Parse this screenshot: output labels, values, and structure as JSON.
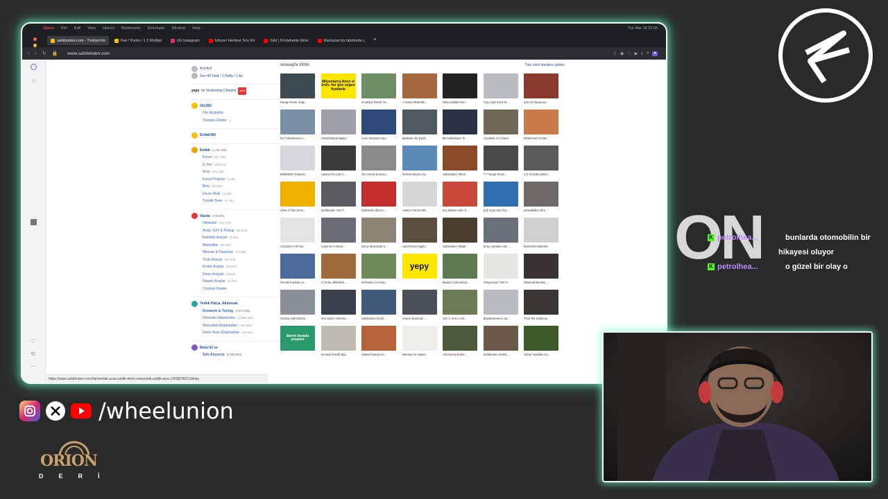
{
  "browser": {
    "menubar": {
      "brand": "Opera",
      "items": [
        "File",
        "Edit",
        "View",
        "History",
        "Bookmarks",
        "Developer",
        "Window",
        "Help"
      ],
      "clock": "Tue Mar 18 22:50"
    },
    "tabs": [
      {
        "label": "sahibinden.com - Türkiye'nin",
        "active": true,
        "color": "#f2c300"
      },
      {
        "label": "Fiat / Punto / 1.3 Multijet",
        "active": false,
        "color": "#f2c300"
      },
      {
        "label": "(4) Instagram",
        "active": false,
        "color": "#e1306c"
      },
      {
        "label": "İzleyen Herkesi Ters Kö",
        "active": false,
        "color": "#ff0000"
      },
      {
        "label": "Gibi | Köstebekle tütün",
        "active": false,
        "color": "#ff0000"
      },
      {
        "label": "Ramazan'da fabrikada ç",
        "active": false,
        "color": "#ff0000"
      }
    ],
    "tab_add": "+",
    "url": "www.sahibinden.com",
    "status_url": "https://www.sahibinden.com/ilan/emlak-arsa-satilik-deniz-manzarali-satilik-arsa-1269878621/detay"
  },
  "categories": {
    "top": [
      {
        "label": "Acil Acil",
        "icon": "clock-icon"
      },
      {
        "label": "Son 48 Saat / 1 Hafta / 1 Ay",
        "icon": "clock-icon"
      }
    ],
    "yepy": {
      "brand": "yepy",
      "label": "ile Yenilenmiş Cihazlar",
      "badge": "yeni"
    },
    "oto360": {
      "title": "Oto360",
      "items": [
        "Oto Ekspertiz",
        "Tümünü Göster"
      ]
    },
    "emlak360": {
      "title": "Emlak360"
    },
    "emlak": {
      "title": "Emlak",
      "count": "(1.290.408)",
      "items": [
        {
          "label": "Konut",
          "count": "(847.346)"
        },
        {
          "label": "İş Yeri",
          "count": "(120.614)"
        },
        {
          "label": "Arsa",
          "count": "(321.182)"
        },
        {
          "label": "Konut Projeleri",
          "count": "(1.46)"
        },
        {
          "label": "Bina",
          "count": "(10.534)"
        },
        {
          "label": "Devre Mülk",
          "count": "(2.229)"
        },
        {
          "label": "Turistik Tesis",
          "count": "(2.736)"
        }
      ]
    },
    "vasita": {
      "title": "Vasıta",
      "count": "(738.899)",
      "items": [
        {
          "label": "Otomobil",
          "count": "(331.742)"
        },
        {
          "label": "Arazi, SUV & Pickup",
          "count": "(85.223)"
        },
        {
          "label": "Elektrikli Araçlar",
          "count": "(9.612)"
        },
        {
          "label": "Motosiklet",
          "count": "(89.192)"
        },
        {
          "label": "Minivan & Panelvan",
          "count": "(27.395)"
        },
        {
          "label": "Ticari Araçlar",
          "count": "(51.976)"
        },
        {
          "label": "Kiralık Araçlar",
          "count": "(48.557)"
        },
        {
          "label": "Deniz Araçları",
          "count": "(6.556)"
        },
        {
          "label": "Hasarlı Araçlar",
          "count": "(4.330)"
        },
        {
          "label": "Tümünü Göster",
          "count": ""
        }
      ]
    },
    "yedek": {
      "title": "Yedek Parça, Aksesuar,",
      "title2": "Donanım & Tuning",
      "count": "(3.072.996)",
      "items": [
        {
          "label": "Otomotiv Ekipmanları",
          "count": "(1.286.109)"
        },
        {
          "label": "Motosiklet Ekipmanları",
          "count": "(150.959)"
        },
        {
          "label": "Deniz Aracı Ekipmanları",
          "count": "(20.615)"
        }
      ]
    },
    "ikinci": {
      "title": "İkinci El ve",
      "title2": "Sıfır Alışveriş",
      "count": "(2.988.999)"
    }
  },
  "showcase": {
    "title": "Anasayfa Vitrini",
    "link": "Tüm vitrin ilanlarını göster",
    "items": [
      {
        "caption": "Range Rover Vogu...",
        "color": "#3c4a52",
        "text": ""
      },
      {
        "caption": "",
        "color": "#ffe600",
        "text": "Milyonlarca ikinci el ürün, her gün uygun fiyatlarla"
      },
      {
        "caption": "Guardya Teknik Ya...",
        "color": "#6e8f66",
        "text": ""
      },
      {
        "caption": "A Grubu Müteahh...",
        "color": "#a5673f",
        "text": ""
      },
      {
        "caption": "Nikon Dijital Foto...",
        "color": "#222222",
        "text": ""
      },
      {
        "caption": "Fray Cars 2014 M...",
        "color": "#b9bcc0",
        "text": ""
      },
      {
        "caption": "410 Cm Beyonce...",
        "color": "#8b3a2e",
        "text": ""
      },
      {
        "caption": "İnz Tutkunlarına A...",
        "color": "#7a8fa6",
        "text": ""
      },
      {
        "caption": "Grand Bayrampaşa...",
        "color": "#9a9ea8",
        "text": ""
      },
      {
        "caption": "Acev Denizyal Van...",
        "color": "#2d4a7a",
        "text": ""
      },
      {
        "caption": "Balıkesir Altı Eylül...",
        "color": "#4f5962",
        "text": ""
      },
      {
        "caption": "Bk Sahibinden Te...",
        "color": "#2a3140",
        "text": ""
      },
      {
        "caption": "4 Eylülde 3+1 Daire",
        "color": "#6d6858",
        "text": ""
      },
      {
        "caption": "Mükemmel Fırsat...",
        "color": "#c87a48",
        "text": ""
      },
      {
        "caption": "999000km Futuristi...",
        "color": "#d8d8dc",
        "text": ""
      },
      {
        "caption": "Lavinia Pro 125 C...",
        "color": "#3b3b3b",
        "text": ""
      },
      {
        "caption": "Oto Servis Konusu...",
        "color": "#8c8c8c",
        "text": ""
      },
      {
        "caption": "Re/max Beyaz | B...",
        "color": "#5a8ab8",
        "text": ""
      },
      {
        "caption": "Sahibinden Takım...",
        "color": "#8a4a2a",
        "text": ""
      },
      {
        "caption": "*****range Rover...",
        "color": "#4a4a48",
        "text": ""
      },
      {
        "caption": "1.6 Tdi Doly Motor...",
        "color": "#5a5a58",
        "text": ""
      },
      {
        "caption": "Libre 2 Plus Sens...",
        "color": "#f0b000",
        "text": ""
      },
      {
        "caption": "Sahibinden Yeni T...",
        "color": "#5b5d60",
        "text": ""
      },
      {
        "caption": "Doktorda Alfa Ro...",
        "color": "#c22c2c",
        "text": ""
      },
      {
        "caption": "Hatasız Temiz Alfe...",
        "color": "#d4d6d8",
        "text": ""
      },
      {
        "caption": "Dış Mekan Kafe Ti...",
        "color": "#c84a3a",
        "text": ""
      },
      {
        "caption": "Şok Fiyat Sea Par...",
        "color": "#2f6fb0",
        "text": ""
      },
      {
        "caption": "Zentalkilliru Ultra ...",
        "color": "#6d6a66",
        "text": ""
      },
      {
        "caption": "Civicdan 9.70 lme...",
        "color": "#e3e3e3",
        "text": ""
      },
      {
        "caption": "Cayenne Carbon...",
        "color": "#6a6e74",
        "text": ""
      },
      {
        "caption": "Deniz Manzaralı S...",
        "color": "#8c8474",
        "text": ""
      },
      {
        "caption": "Land Rover İngiliz...",
        "color": "#5a4e3e",
        "text": ""
      },
      {
        "caption": "Sahibinden Tabati...",
        "color": "#4a3e30",
        "text": ""
      },
      {
        "caption": "Sıraç Autodan Hat...",
        "color": "#6a707a",
        "text": ""
      },
      {
        "caption": "Mazraflısz Bakımlı...",
        "color": "#cfd0d2",
        "text": ""
      },
      {
        "caption": "Pendik Kurtköy Le...",
        "color": "#4a6a9a",
        "text": ""
      },
      {
        "caption": "G Grubu Müteahh...",
        "color": "#a06a3a",
        "text": ""
      },
      {
        "caption": "Defender 2.0 Kola...",
        "color": "#6e8a5a",
        "text": ""
      },
      {
        "caption": "",
        "color": "#ffe600",
        "text": "yepy"
      },
      {
        "caption": "Beykoz Çekmeköp...",
        "color": "#5f7a52",
        "text": ""
      },
      {
        "caption": "Temponsan Türk P...",
        "color": "#e8e6e0",
        "text": ""
      },
      {
        "caption": "Maserati Bentley ...",
        "color": "#3a3232",
        "text": ""
      },
      {
        "caption": "Gümüş Hak Motors...",
        "color": "#8a9098",
        "text": ""
      },
      {
        "caption": "Ktm Super Adventu...",
        "color": "#3a4250",
        "text": ""
      },
      {
        "caption": "Sahibinden İzmit/...",
        "color": "#3f5a7a",
        "text": ""
      },
      {
        "caption": "Anacm Borsmaz ...",
        "color": "#4a5058",
        "text": ""
      },
      {
        "caption": "Sen 1 Gün 1 Acil...",
        "color": "#6a7a52",
        "text": ""
      },
      {
        "caption": "Büyükçekmece Sa...",
        "color": "#b8bcc0",
        "text": ""
      },
      {
        "caption": "Tl'de Tek Gelişmiş...",
        "color": "#3a3634",
        "text": ""
      },
      {
        "caption": "",
        "color": "#2a9a6a",
        "text": "ilanım burada yeralsın"
      },
      {
        "caption": "Sevrasz Kredili Eği...",
        "color": "#c0bbb2",
        "text": ""
      },
      {
        "caption": "Vadepl Karpuz im...",
        "color": "#b8643a",
        "text": ""
      },
      {
        "caption": "Metroya Ve Hasta...",
        "color": "#ecece8",
        "text": ""
      },
      {
        "caption": "Akıl Dereyok den...",
        "color": "#4a5a3a",
        "text": ""
      },
      {
        "caption": "Sahibinden Satılık...",
        "color": "#6a5a4a",
        "text": ""
      },
      {
        "caption": "Saray Yurakda Ha...",
        "color": "#3e5a2a",
        "text": ""
      }
    ]
  },
  "overlay": {
    "on_text": "ON",
    "chat": [
      {
        "user": "petrolhea...",
        "msg": "bunlarda otomobilin bir"
      },
      {
        "cont": "hikayesi oluyor"
      },
      {
        "user": "petrolhea...",
        "msg": "o güzel bir olay o"
      }
    ],
    "social_handle": "/wheelunion",
    "sponsor": {
      "name": "ORION",
      "sub": "DERİ"
    }
  },
  "colors": {
    "accent_glow": "#7dffd6",
    "sahibinden_blue": "#1a4a9a",
    "brand_yellow": "#ffe600"
  }
}
